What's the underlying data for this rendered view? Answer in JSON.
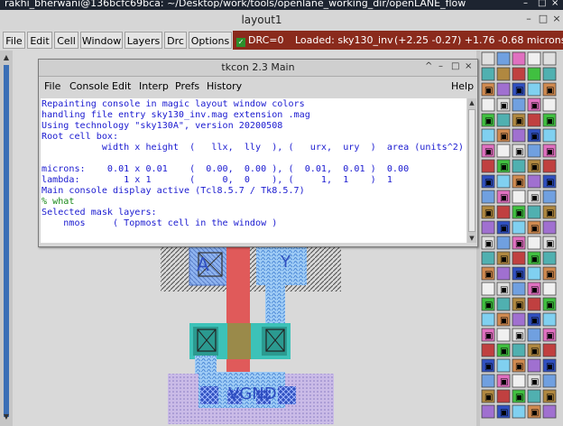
{
  "outer_window": {
    "title": "rakhi_bherwani@136bcfc69bca: ~/Desktop/work/tools/openlane_working_dir/openLANE_flow",
    "controls": [
      "–",
      "□",
      "×"
    ]
  },
  "layout_window": {
    "title": "layout1",
    "controls": [
      "–",
      "□",
      "×"
    ]
  },
  "menubar": {
    "items": [
      "File",
      "Edit",
      "Cell",
      "Window",
      "Layers",
      "Drc",
      "Options"
    ],
    "drc_label": "DRC=0",
    "loaded_text": "Loaded: sky130_inv",
    "coordinates_text": "(+2.25 -0.27) +1.76 -0.68 microns"
  },
  "layout_labels": {
    "a": "A",
    "y": "Y",
    "vgnd": "VGND"
  },
  "tkcon": {
    "title": "tkcon 2.3 Main",
    "title_controls": [
      "^",
      "–",
      "□",
      "×"
    ],
    "menu": [
      "File",
      "Console",
      "Edit",
      "Interp",
      "Prefs",
      "History"
    ],
    "help": "Help",
    "console_lines": [
      "Repainting console in magic layout window colors",
      "handling file entry sky130_inv.mag extension .mag",
      "Using technology \"sky130A\", version 20200508",
      "Root cell box:",
      "           width x height  (   llx,  lly  ), (   urx,  ury  )  area (units^2)",
      "",
      "microns:    0.01 x 0.01    (  0.00,  0.00 ), (  0.01,  0.01 )  0.00",
      "lambda:        1 x 1       (     0,  0    ), (     1,  1    )  1",
      "Main console display active (Tcl8.5.7 / Tk8.5.7)"
    ],
    "prompt_line": "% what",
    "result_lines": [
      "Selected mask layers:",
      "    nmos     ( Topmost cell in the window )"
    ]
  },
  "colors": {
    "title_bar": "#1d2430",
    "drc_bar": "#8a2a1c",
    "console_text": "#1a1ad0",
    "prompt_text": "#1d8a1d"
  }
}
